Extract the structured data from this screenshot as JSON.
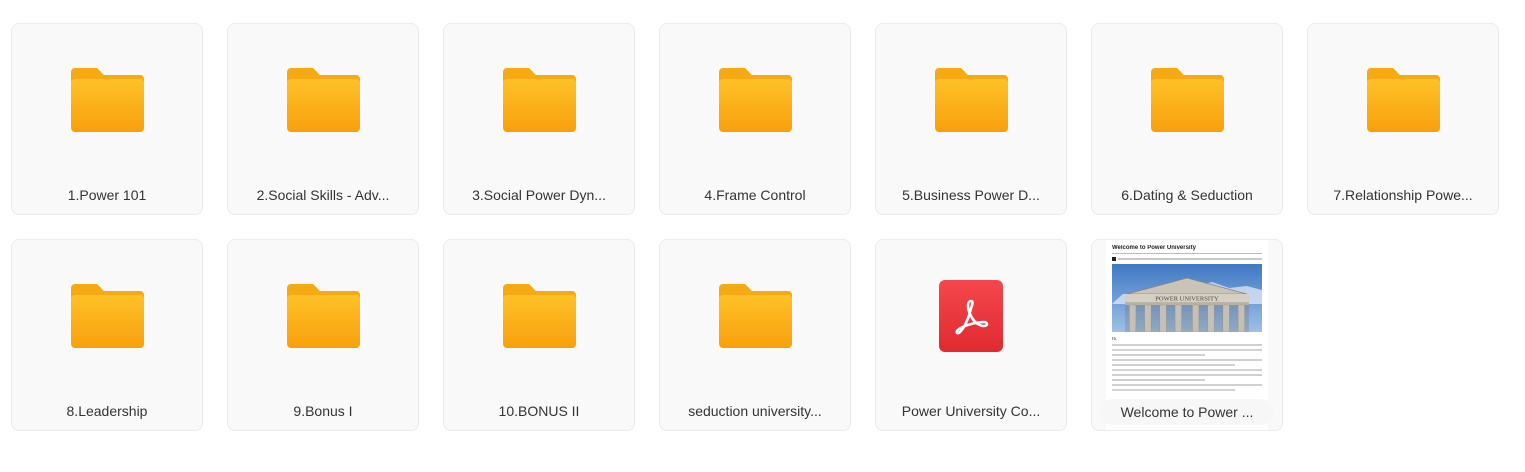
{
  "files": [
    {
      "name": "1.Power 101",
      "type": "folder",
      "icon": "folder-icon"
    },
    {
      "name": "2.Social Skills - Adv...",
      "type": "folder",
      "icon": "folder-icon"
    },
    {
      "name": "3.Social Power Dyn...",
      "type": "folder",
      "icon": "folder-icon"
    },
    {
      "name": "4.Frame Control",
      "type": "folder",
      "icon": "folder-icon"
    },
    {
      "name": "5.Business Power D...",
      "type": "folder",
      "icon": "folder-icon"
    },
    {
      "name": "6.Dating & Seduction",
      "type": "folder",
      "icon": "folder-icon"
    },
    {
      "name": "7.Relationship Powe...",
      "type": "folder",
      "icon": "folder-icon"
    },
    {
      "name": "8.Leadership",
      "type": "folder",
      "icon": "folder-icon"
    },
    {
      "name": "9.Bonus I",
      "type": "folder",
      "icon": "folder-icon"
    },
    {
      "name": "10.BONUS II",
      "type": "folder",
      "icon": "folder-icon"
    },
    {
      "name": "seduction university...",
      "type": "folder",
      "icon": "folder-icon"
    },
    {
      "name": "Power University Co...",
      "type": "pdf",
      "icon": "pdf-icon"
    },
    {
      "name": "Welcome to Power ...",
      "type": "document-preview",
      "icon": "document-thumbnail"
    }
  ],
  "preview": {
    "doc_title": "Welcome to Power University",
    "building_sign": "POWER UNIVERSITY",
    "greeting": "Hi,"
  },
  "colors": {
    "folder_top": "#fec127",
    "folder_bottom": "#f8a20d",
    "folder_tab": "#f5aa13",
    "pdf_red": "#e8353a"
  }
}
